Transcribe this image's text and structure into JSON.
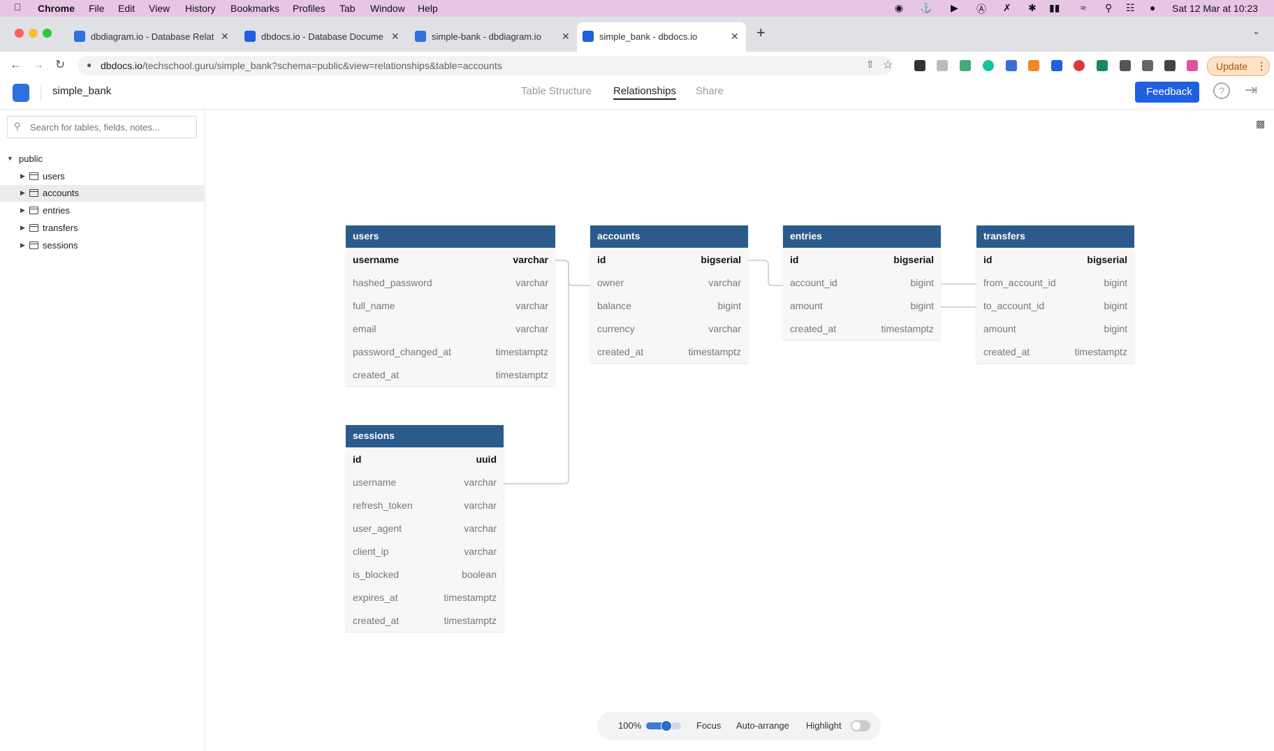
{
  "menubar": {
    "items": [
      "Chrome",
      "File",
      "Edit",
      "View",
      "History",
      "Bookmarks",
      "Profiles",
      "Tab",
      "Window",
      "Help"
    ],
    "datetime": "Sat 12 Mar at 10:23"
  },
  "tabs": [
    {
      "title": "dbdiagram.io - Database Relati",
      "favicon": "dbdiagram-icon"
    },
    {
      "title": "dbdocs.io - Database Docume",
      "favicon": "dbdocs-icon"
    },
    {
      "title": "simple-bank - dbdiagram.io",
      "favicon": "dbdiagram-icon"
    },
    {
      "title": "simple_bank - dbdocs.io",
      "favicon": "dbdocs-icon",
      "active": true
    }
  ],
  "address": {
    "url_host": "dbdocs.io",
    "url_path": "/techschool.guru/simple_bank?schema=public&view=relationships&table=accounts"
  },
  "update_label": "Update",
  "header": {
    "project": "simple_bank",
    "nav": [
      "Table Structure",
      "Relationships",
      "Share"
    ],
    "active_nav": "Relationships",
    "feedback_label": "Feedback"
  },
  "sidebar": {
    "search_placeholder": "Search for tables, fields, notes...",
    "schema": "public",
    "tables": [
      "users",
      "accounts",
      "entries",
      "transfers",
      "sessions"
    ],
    "selected": "accounts"
  },
  "tables": {
    "users": {
      "name": "users",
      "fields": [
        {
          "name": "username",
          "type": "varchar",
          "pk": true
        },
        {
          "name": "hashed_password",
          "type": "varchar"
        },
        {
          "name": "full_name",
          "type": "varchar"
        },
        {
          "name": "email",
          "type": "varchar"
        },
        {
          "name": "password_changed_at",
          "type": "timestamptz"
        },
        {
          "name": "created_at",
          "type": "timestamptz"
        }
      ]
    },
    "accounts": {
      "name": "accounts",
      "fields": [
        {
          "name": "id",
          "type": "bigserial",
          "pk": true
        },
        {
          "name": "owner",
          "type": "varchar"
        },
        {
          "name": "balance",
          "type": "bigint"
        },
        {
          "name": "currency",
          "type": "varchar"
        },
        {
          "name": "created_at",
          "type": "timestamptz"
        }
      ]
    },
    "entries": {
      "name": "entries",
      "fields": [
        {
          "name": "id",
          "type": "bigserial",
          "pk": true
        },
        {
          "name": "account_id",
          "type": "bigint"
        },
        {
          "name": "amount",
          "type": "bigint"
        },
        {
          "name": "created_at",
          "type": "timestamptz"
        }
      ]
    },
    "transfers": {
      "name": "transfers",
      "fields": [
        {
          "name": "id",
          "type": "bigserial",
          "pk": true
        },
        {
          "name": "from_account_id",
          "type": "bigint"
        },
        {
          "name": "to_account_id",
          "type": "bigint"
        },
        {
          "name": "amount",
          "type": "bigint"
        },
        {
          "name": "created_at",
          "type": "timestamptz"
        }
      ]
    },
    "sessions": {
      "name": "sessions",
      "fields": [
        {
          "name": "id",
          "type": "uuid",
          "pk": true
        },
        {
          "name": "username",
          "type": "varchar"
        },
        {
          "name": "refresh_token",
          "type": "varchar"
        },
        {
          "name": "user_agent",
          "type": "varchar"
        },
        {
          "name": "client_ip",
          "type": "varchar"
        },
        {
          "name": "is_blocked",
          "type": "boolean"
        },
        {
          "name": "expires_at",
          "type": "timestamptz"
        },
        {
          "name": "created_at",
          "type": "timestamptz"
        }
      ]
    }
  },
  "toolbar": {
    "zoom": "100%",
    "zoom_fraction": 0.55,
    "focus_label": "Focus",
    "autoarrange_label": "Auto-arrange",
    "highlight_label": "Highlight",
    "highlight_on": false
  },
  "colors": {
    "table_header": "#2a5b8c",
    "primary": "#1f5fe0"
  }
}
